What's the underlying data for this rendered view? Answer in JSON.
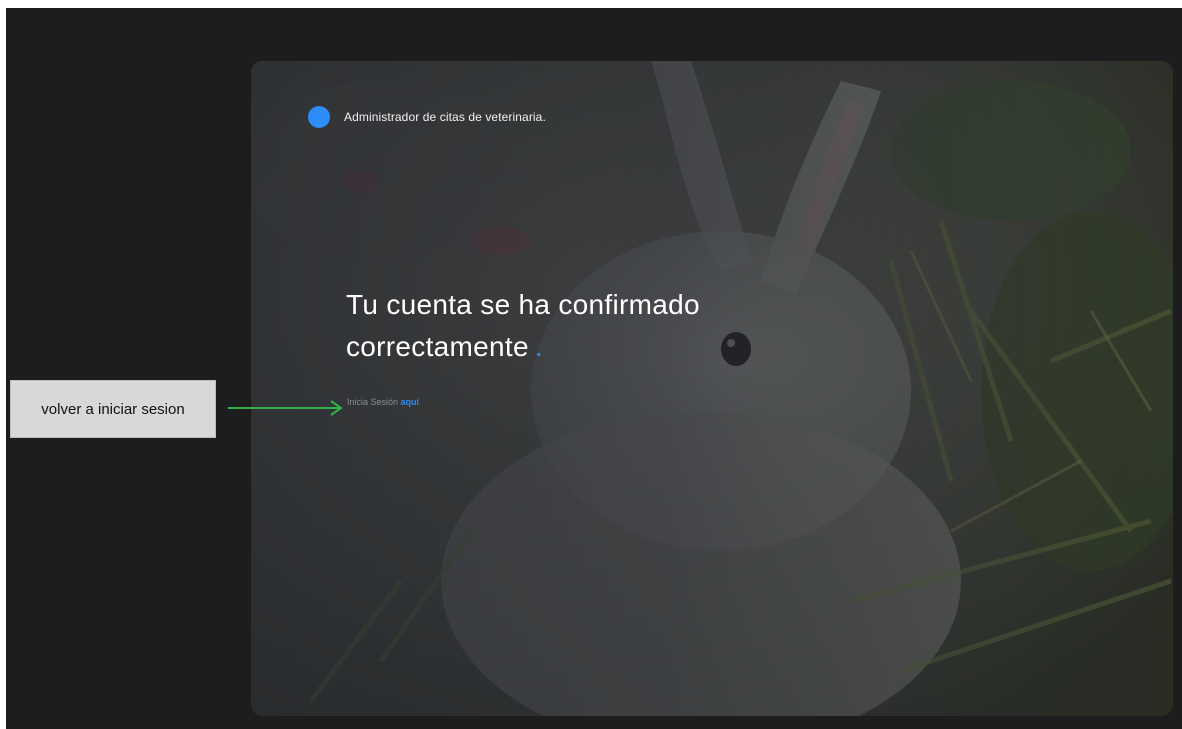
{
  "brand": {
    "title": "Administrador de citas de veterinaria."
  },
  "headline": {
    "line1": "Tu cuenta se ha confirmado",
    "line2": "correctamente",
    "dot": "."
  },
  "login": {
    "prefix": "Inicia Sesión",
    "link": "aquí"
  },
  "annotation": {
    "label": "volver a iniciar sesion"
  },
  "colors": {
    "accent": "#2e8cf8",
    "arrow": "#2fb24a",
    "background": "#1d1d1d"
  }
}
